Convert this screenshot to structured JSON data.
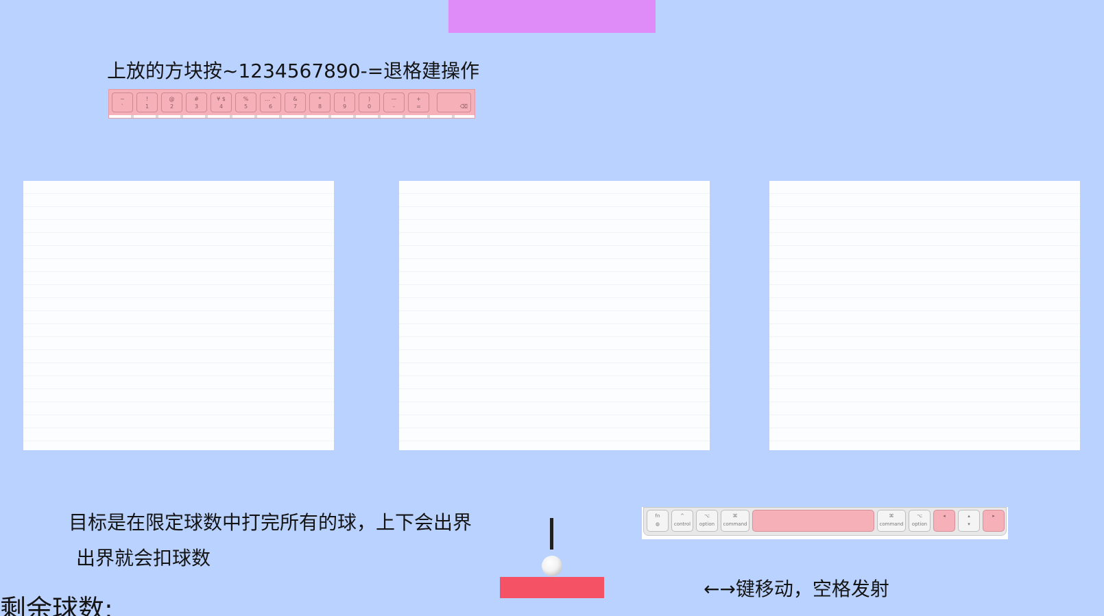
{
  "colors": {
    "background": "#bad2ff",
    "top_bar": "#e08cf8",
    "paddle": "#f55266",
    "keyboard_highlight": "#f6b0b8",
    "panel": "#fbfdff"
  },
  "instructions": {
    "top": "上放的方块按~1234567890-=退格建操作",
    "goal_line1": "目标是在限定球数中打完所有的球，上下会出界",
    "goal_line2": "出界就会扣球数",
    "move_hint": "←→键移动，空格发射",
    "remaining_label": "剩余球数:"
  },
  "number_row_keys": [
    {
      "top": "~",
      "bottom": "`"
    },
    {
      "top": "!",
      "bottom": "1"
    },
    {
      "top": "@",
      "bottom": "2"
    },
    {
      "top": "#",
      "bottom": "3"
    },
    {
      "top": "¥ $",
      "bottom": "4"
    },
    {
      "top": "%",
      "bottom": "5"
    },
    {
      "top": "… ^",
      "bottom": "6"
    },
    {
      "top": "&",
      "bottom": "7"
    },
    {
      "top": "*",
      "bottom": "8"
    },
    {
      "top": "(",
      "bottom": "9"
    },
    {
      "top": ")",
      "bottom": "0"
    },
    {
      "top": "—",
      "bottom": "-"
    },
    {
      "top": "+",
      "bottom": "="
    },
    {
      "top": "",
      "bottom": "⌫"
    }
  ],
  "bottom_row_keys": [
    {
      "top": "fn",
      "bottom": "◍",
      "highlight": false
    },
    {
      "top": "^",
      "bottom": "control",
      "highlight": false
    },
    {
      "top": "⌥",
      "bottom": "option",
      "highlight": false
    },
    {
      "top": "⌘",
      "bottom": "command",
      "highlight": false
    },
    {
      "top": "",
      "bottom": "",
      "highlight": true
    },
    {
      "top": "⌘",
      "bottom": "command",
      "highlight": false
    },
    {
      "top": "⌥",
      "bottom": "option",
      "highlight": false
    },
    {
      "top": "◂",
      "bottom": "",
      "highlight": true
    },
    {
      "top": "▴",
      "bottom": "▾",
      "highlight": false
    },
    {
      "top": "▸",
      "bottom": "",
      "highlight": true
    }
  ]
}
